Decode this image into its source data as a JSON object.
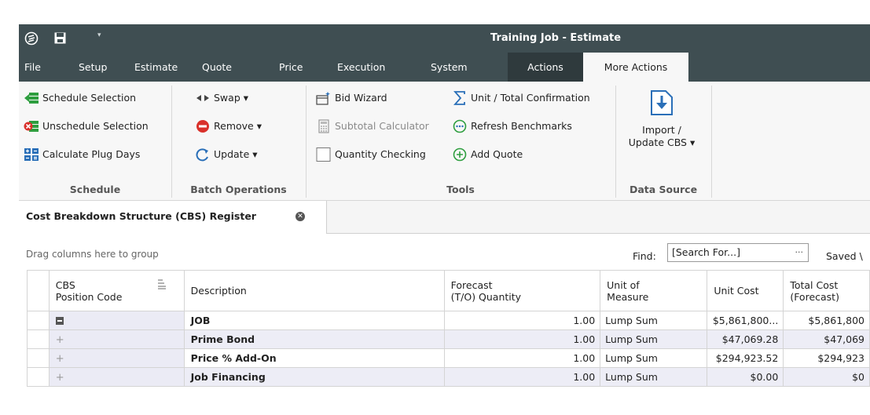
{
  "window": {
    "title": "Training Job - Estimate",
    "qat_dropdown": "▾"
  },
  "menu": {
    "tabs": [
      "File",
      "Setup",
      "Estimate",
      "Quote",
      "Price",
      "Execution",
      "System",
      "Actions",
      "More Actions"
    ]
  },
  "ribbon": {
    "schedule": {
      "items": [
        "Schedule Selection",
        "Unschedule Selection",
        "Calculate Plug Days"
      ],
      "label": "Schedule"
    },
    "batch": {
      "items": [
        "Swap ▾",
        "Remove ▾",
        "Update ▾"
      ],
      "label": "Batch Operations"
    },
    "tools": {
      "col1": [
        "Bid Wizard",
        "Subtotal Calculator",
        "Quantity Checking"
      ],
      "col2": [
        "Unit / Total Confirmation",
        "Refresh Benchmarks",
        "Add Quote"
      ],
      "label": "Tools"
    },
    "datasource": {
      "import_line1": "Import /",
      "import_line2": "Update CBS ▾",
      "label": "Data Source"
    }
  },
  "document": {
    "tab_title": "Cost Breakdown Structure (CBS) Register",
    "close_glyph": "✕"
  },
  "grid_toolbar": {
    "group_hint": "Drag columns here to group",
    "find_label": "Find:",
    "find_value": "[Search For...]",
    "find_button": "···",
    "saved_label": "Saved \\"
  },
  "grid": {
    "headers": {
      "code_1": "CBS",
      "code_2": "Position Code",
      "description": "Description",
      "forecast_1": "Forecast",
      "forecast_2": "(T/O) Quantity",
      "uom_1": "Unit of",
      "uom_2": "Measure",
      "unit_cost": "Unit Cost",
      "total_1": "Total Cost",
      "total_2": "(Forecast)"
    },
    "rows": [
      {
        "description": "JOB",
        "quantity": "1.00",
        "uom": "Lump Sum",
        "unit_cost": "$5,861,800...",
        "total": "$5,861,800"
      },
      {
        "description": "Prime Bond",
        "quantity": "1.00",
        "uom": "Lump Sum",
        "unit_cost": "$47,069.28",
        "total": "$47,069"
      },
      {
        "description": "Price % Add-On",
        "quantity": "1.00",
        "uom": "Lump Sum",
        "unit_cost": "$294,923.52",
        "total": "$294,923"
      },
      {
        "description": "Job Financing",
        "quantity": "1.00",
        "uom": "Lump Sum",
        "unit_cost": "$0.00",
        "total": "$0"
      }
    ],
    "expand_glyph": "+"
  },
  "colors": {
    "titlebar": "#3f4e52",
    "actions_tab": "#2f3a3d",
    "ribbon_bg": "#f7f7f7",
    "row_band": "#ededf6",
    "accent_green": "#2e9e3f",
    "accent_red": "#d9302a",
    "accent_blue": "#2a6fb8"
  },
  "icons": [
    "app-logo-icon",
    "save-icon",
    "schedule-icon",
    "unschedule-icon",
    "calculate-icon",
    "swap-icon",
    "remove-icon",
    "update-icon",
    "bid-wizard-icon",
    "calculator-icon",
    "checkbox-icon",
    "sigma-icon",
    "refresh-icon",
    "add-quote-icon",
    "import-icon",
    "close-icon",
    "sort-icon",
    "collapse-icon",
    "expand-icon"
  ]
}
